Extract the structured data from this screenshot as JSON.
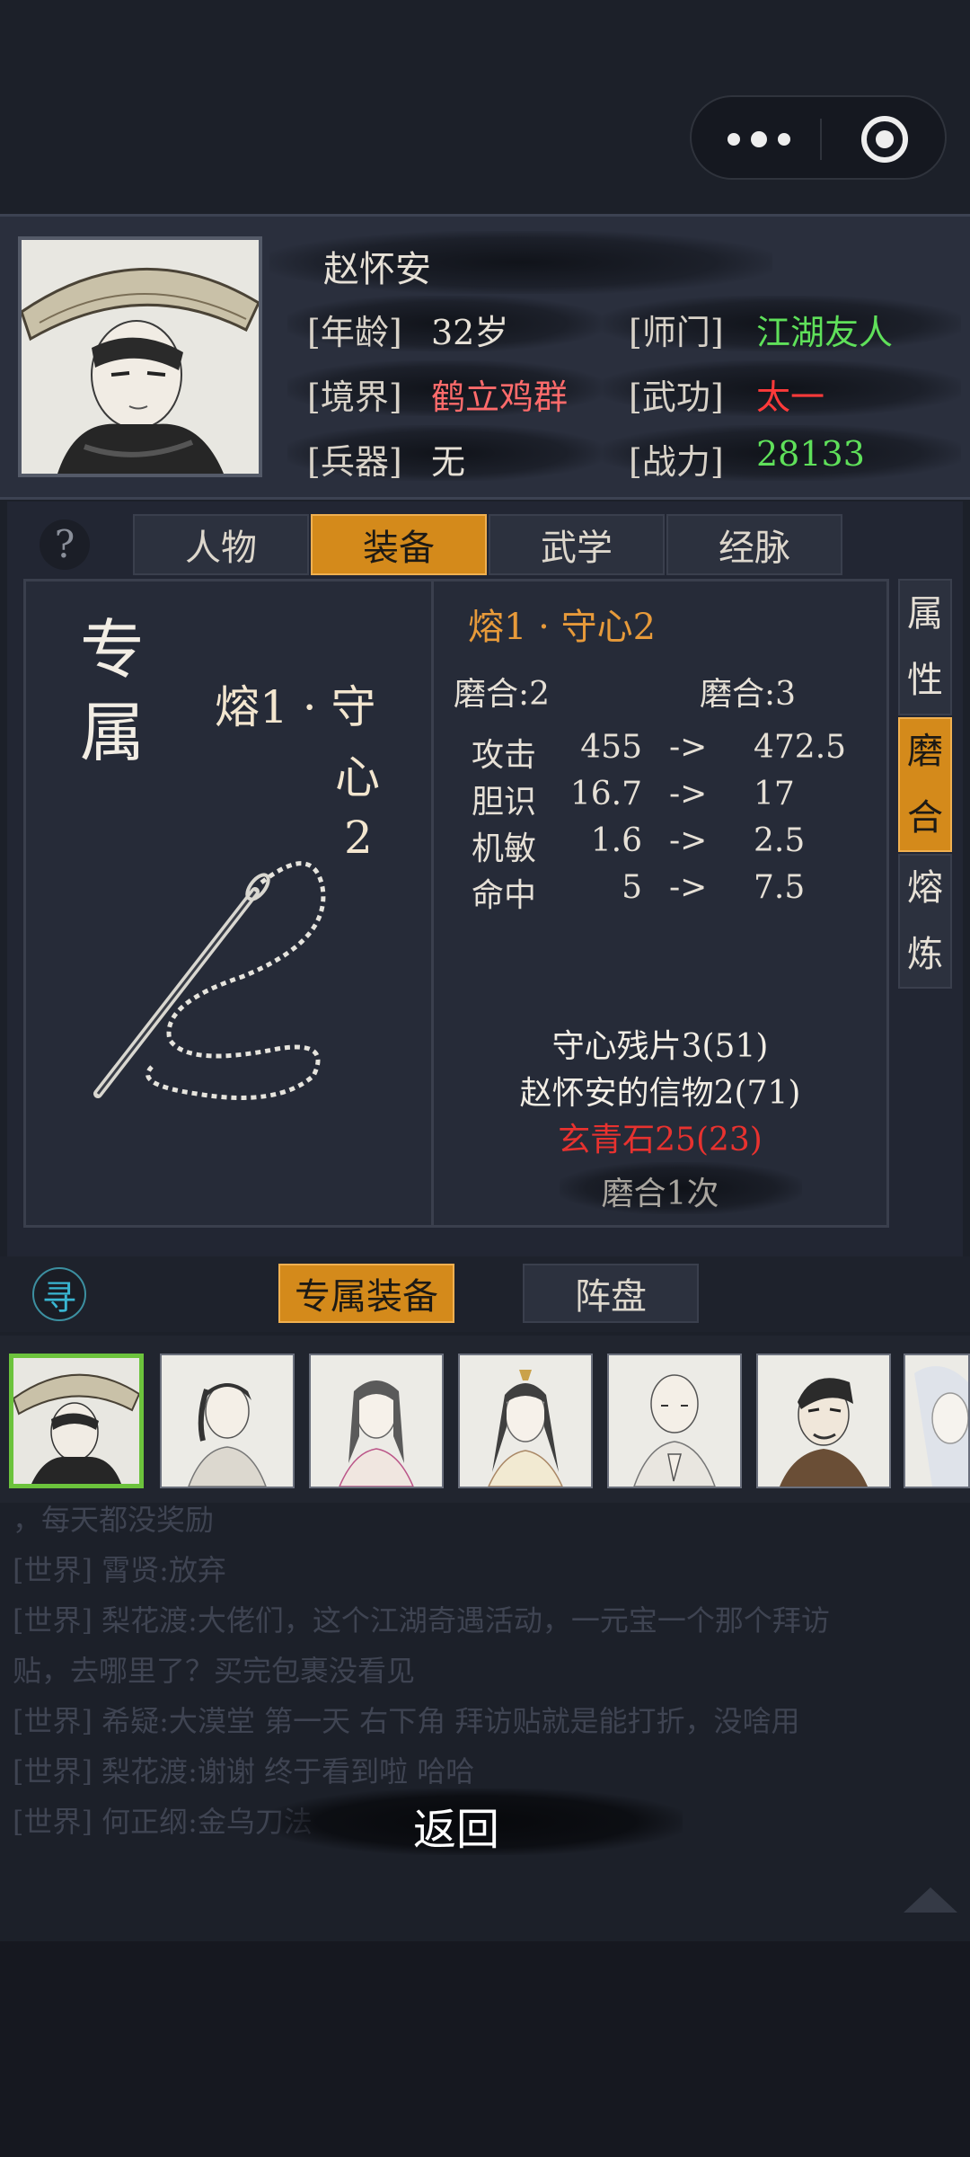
{
  "topbar": {
    "menu_icon": "more-dots-icon",
    "close_icon": "target-circle-icon"
  },
  "hero": {
    "name": "赵怀安",
    "rows": [
      {
        "label": "[年龄]",
        "value": "32岁",
        "color": "#e6e0d6"
      },
      {
        "label": "[师门]",
        "value": "江湖友人",
        "color": "#5fe05a"
      },
      {
        "label": "[境界]",
        "value": "鹤立鸡群",
        "color": "#ff6b6b"
      },
      {
        "label": "[武功]",
        "value": "太一",
        "color": "#ff3a3a"
      },
      {
        "label": "[兵器]",
        "value": "无",
        "color": "#e6e0d6"
      },
      {
        "label": "[战力]",
        "value": "28133",
        "color": "#5fe05a"
      }
    ]
  },
  "tabs": {
    "help_icon": "question-icon",
    "items": [
      "人物",
      "装备",
      "武学",
      "经脉"
    ],
    "active_index": 1
  },
  "item": {
    "badge": "专属",
    "title_lines": [
      "熔1 · 守",
      "心",
      "2"
    ],
    "art_icon": "needle-thread-icon"
  },
  "detail": {
    "title": "熔1 · 守心2",
    "col_left": "磨合:2",
    "col_right": "磨合:3",
    "stats": [
      {
        "name": "攻击",
        "from": "455",
        "arrow": "->",
        "to": "472.5"
      },
      {
        "name": "胆识",
        "from": "16.7",
        "arrow": "->",
        "to": "17"
      },
      {
        "name": "机敏",
        "from": "1.6",
        "arrow": "->",
        "to": "2.5"
      },
      {
        "name": "命中",
        "from": "5",
        "arrow": "->",
        "to": "7.5"
      }
    ],
    "materials": [
      {
        "text": "守心残片3(51)",
        "color": "#f2ede4"
      },
      {
        "text": "赵怀安的信物2(71)",
        "color": "#f2ede4"
      },
      {
        "text": "玄青石25(23)",
        "color": "#e8322f"
      }
    ],
    "action_label": "磨合1次"
  },
  "side_tabs": {
    "items": [
      [
        "属",
        "性"
      ],
      [
        "磨",
        "合"
      ],
      [
        "熔",
        "炼"
      ]
    ],
    "active_index": 1
  },
  "bottom_tabs": {
    "search_icon_char": "寻",
    "items": [
      "专属装备",
      "阵盘"
    ],
    "active_index": 0
  },
  "characters": {
    "selected_index": 0,
    "count": 7
  },
  "chat": [
    "，每天都没奖励",
    "[世界] 霄贤:放弃",
    "[世界] 梨花渡:大佬们，这个江湖奇遇活动，一元宝一个那个拜访",
    "贴，去哪里了？买完包裹没看见",
    "[世界] 希疑:大漠堂 第一天 右下角 拜访贴就是能打折，没啥用",
    "[世界] 梨花渡:谢谢 终于看到啦 哈哈",
    "[世界] 何正纲:金乌刀法"
  ],
  "back_label": "返回",
  "scroll_top_icon": "triangle-up-icon"
}
